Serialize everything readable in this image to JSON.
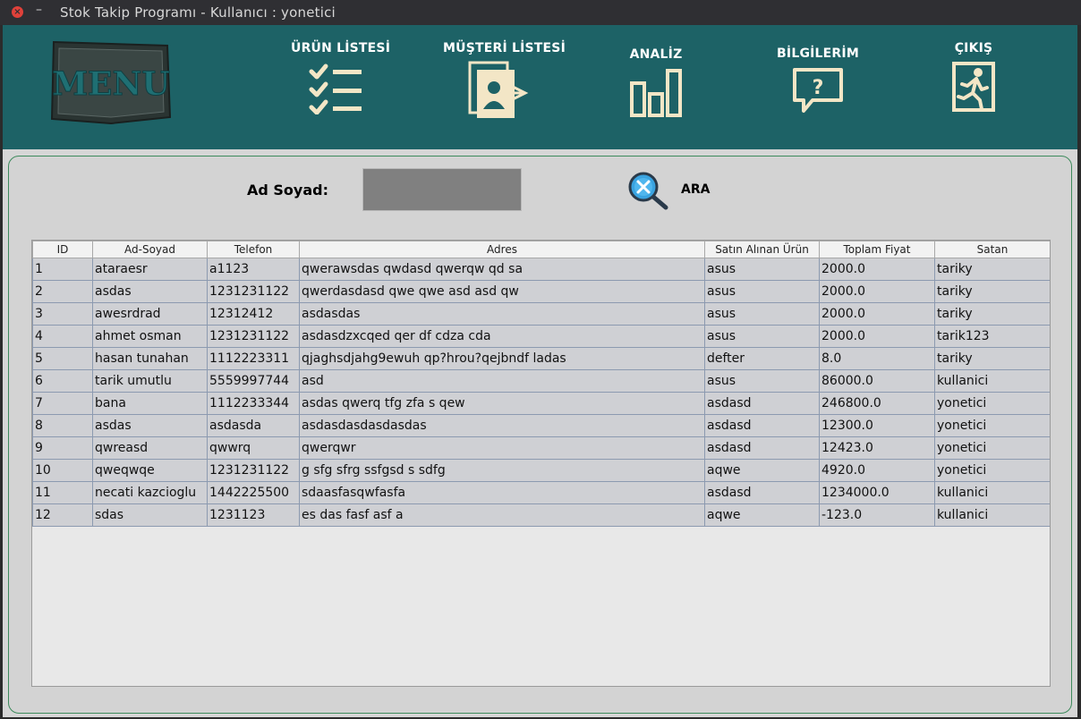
{
  "window": {
    "title": "Stok Takip Programı - Kullanıcı : yonetici",
    "close_glyph": "×",
    "minimize_glyph": "–"
  },
  "header": {
    "logo_text": "MENU",
    "nav": [
      {
        "label": "ÜRÜN LİSTESİ",
        "icon": "checklist-icon"
      },
      {
        "label": "MÜŞTERİ LİSTESİ",
        "icon": "customer-list-icon"
      },
      {
        "label": "ANALİZ",
        "icon": "bar-chart-icon"
      },
      {
        "label": "BİLGİLERİM",
        "icon": "question-bubble-icon"
      },
      {
        "label": "ÇIKIŞ",
        "icon": "exit-icon"
      }
    ]
  },
  "search": {
    "label": "Ad Soyad:",
    "value": "",
    "button_label": "ARA",
    "icon": "search-icon"
  },
  "table": {
    "columns": [
      "ID",
      "Ad-Soyad",
      "Telefon",
      "Adres",
      "Satın Alınan Ürün",
      "Toplam Fiyat",
      "Satan"
    ],
    "rows": [
      [
        "1",
        "ataraesr",
        "a1123",
        "qwerawsdas qwdasd qwerqw qd sa",
        "asus",
        "2000.0",
        "tariky"
      ],
      [
        "2",
        "asdas",
        "1231231122",
        "qwerdasdasd qwe qwe asd asd qw",
        "asus",
        "2000.0",
        "tariky"
      ],
      [
        "3",
        "awesrdrad",
        "12312412",
        "asdasdas",
        "asus",
        "2000.0",
        "tariky"
      ],
      [
        "4",
        "ahmet osman",
        "1231231122",
        "asdasdzxcqed qer df cdza cda",
        "asus",
        "2000.0",
        "tarik123"
      ],
      [
        "5",
        "hasan tunahan",
        "1112223311",
        "qjaghsdjahg9ewuh qp?hrou?qejbndf ladas",
        "defter",
        "8.0",
        "tariky"
      ],
      [
        "6",
        "tarik umutlu",
        "5559997744",
        "asd",
        "asus",
        "86000.0",
        "kullanici"
      ],
      [
        "7",
        "bana",
        "1112233344",
        "asdas qwerq tfg zfa s qew",
        "asdasd",
        "246800.0",
        "yonetici"
      ],
      [
        "8",
        "asdas",
        "asdasda",
        "asdasdasdasdasdas",
        "asdasd",
        "12300.0",
        "yonetici"
      ],
      [
        "9",
        "qwreasd",
        "qwwrq",
        "qwerqwr",
        "asdasd",
        "12423.0",
        "yonetici"
      ],
      [
        "10",
        "qweqwqe",
        "1231231122",
        "g sfg sfrg ssfgsd s sdfg",
        "aqwe",
        "4920.0",
        "yonetici"
      ],
      [
        "11",
        "necati kazcioglu",
        "1442225500",
        "sdaasfasqwfasfa",
        "asdasd",
        "1234000.0",
        "kullanici"
      ],
      [
        "12",
        "sdas",
        "1231123",
        "es  das fasf asf a",
        "aqwe",
        "-123.0",
        "kullanici"
      ]
    ]
  },
  "colors": {
    "header_bg": "#1d6266",
    "panel_bg": "#d3d3d3",
    "panel_border": "#3d8a5c",
    "row_bg": "#cfd0d4",
    "icon_fill": "#f3e6c6"
  }
}
